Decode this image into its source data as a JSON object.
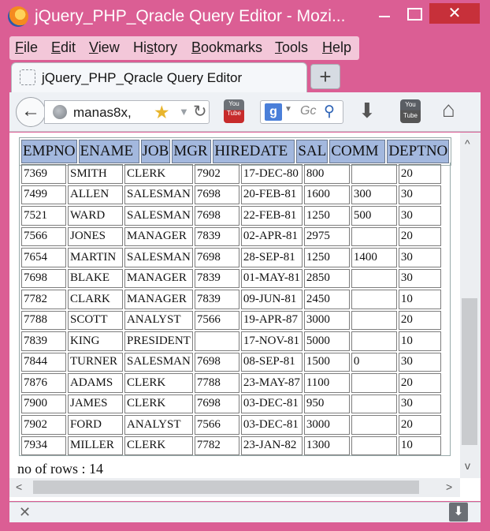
{
  "window": {
    "title": "jQuery_PHP_Qracle Query Editor - Mozi..."
  },
  "menu": {
    "items": [
      {
        "accel": "F",
        "rest": "ile"
      },
      {
        "accel": "E",
        "rest": "dit"
      },
      {
        "accel": "V",
        "rest": "iew"
      },
      {
        "pre": "Hi",
        "accel": "s",
        "rest": "tory"
      },
      {
        "accel": "B",
        "rest": "ookmarks"
      },
      {
        "accel": "T",
        "rest": "ools"
      },
      {
        "accel": "H",
        "rest": "elp"
      }
    ]
  },
  "tab": {
    "label": "jQuery_PHP_Qracle Query Editor",
    "new_tab": "+"
  },
  "nav": {
    "url": "manas8x,",
    "search_placeholder": "Gc",
    "search_engine": "g",
    "yt_label": "You Tube"
  },
  "table": {
    "headers": [
      "EMPNO",
      "ENAME",
      "JOB",
      "MGR",
      "HIREDATE",
      "SAL",
      "COMM",
      "DEPTNO"
    ],
    "rows": [
      [
        "7369",
        "SMITH",
        "CLERK",
        "7902",
        "17-DEC-80",
        "800",
        "",
        "20"
      ],
      [
        "7499",
        "ALLEN",
        "SALESMAN",
        "7698",
        "20-FEB-81",
        "1600",
        "300",
        "30"
      ],
      [
        "7521",
        "WARD",
        "SALESMAN",
        "7698",
        "22-FEB-81",
        "1250",
        "500",
        "30"
      ],
      [
        "7566",
        "JONES",
        "MANAGER",
        "7839",
        "02-APR-81",
        "2975",
        "",
        "20"
      ],
      [
        "7654",
        "MARTIN",
        "SALESMAN",
        "7698",
        "28-SEP-81",
        "1250",
        "1400",
        "30"
      ],
      [
        "7698",
        "BLAKE",
        "MANAGER",
        "7839",
        "01-MAY-81",
        "2850",
        "",
        "30"
      ],
      [
        "7782",
        "CLARK",
        "MANAGER",
        "7839",
        "09-JUN-81",
        "2450",
        "",
        "10"
      ],
      [
        "7788",
        "SCOTT",
        "ANALYST",
        "7566",
        "19-APR-87",
        "3000",
        "",
        "20"
      ],
      [
        "7839",
        "KING",
        "PRESIDENT",
        "",
        "17-NOV-81",
        "5000",
        "",
        "10"
      ],
      [
        "7844",
        "TURNER",
        "SALESMAN",
        "7698",
        "08-SEP-81",
        "1500",
        "0",
        "30"
      ],
      [
        "7876",
        "ADAMS",
        "CLERK",
        "7788",
        "23-MAY-87",
        "1100",
        "",
        "20"
      ],
      [
        "7900",
        "JAMES",
        "CLERK",
        "7698",
        "03-DEC-81",
        "950",
        "",
        "30"
      ],
      [
        "7902",
        "FORD",
        "ANALYST",
        "7566",
        "03-DEC-81",
        "3000",
        "",
        "20"
      ],
      [
        "7934",
        "MILLER",
        "CLERK",
        "7782",
        "23-JAN-82",
        "1300",
        "",
        "10"
      ]
    ]
  },
  "footer": {
    "rows_text": "no of rows : 14"
  },
  "colors": {
    "frame": "#db5e94",
    "header_cell": "#a3b8de",
    "close_button": "#c7303a"
  }
}
